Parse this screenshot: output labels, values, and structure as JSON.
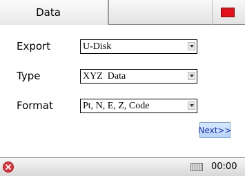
{
  "header": {
    "tab_label": "Data"
  },
  "form": {
    "export": {
      "label": "Export",
      "value": "U-Disk"
    },
    "type": {
      "label": "Type",
      "value": "XYZ  Data"
    },
    "format": {
      "label": "Format",
      "value": "Pt, N, E, Z, Code"
    }
  },
  "actions": {
    "next_label": "Next>>"
  },
  "statusbar": {
    "time": "00:00"
  },
  "colors": {
    "close_red": "#e1101b",
    "next_text": "#1a2fbd",
    "error_red": "#e0323a"
  },
  "icons": {
    "close": "close-icon",
    "dropdown": "chevron-down-icon",
    "error": "error-icon",
    "keyboard": "keyboard-icon"
  }
}
